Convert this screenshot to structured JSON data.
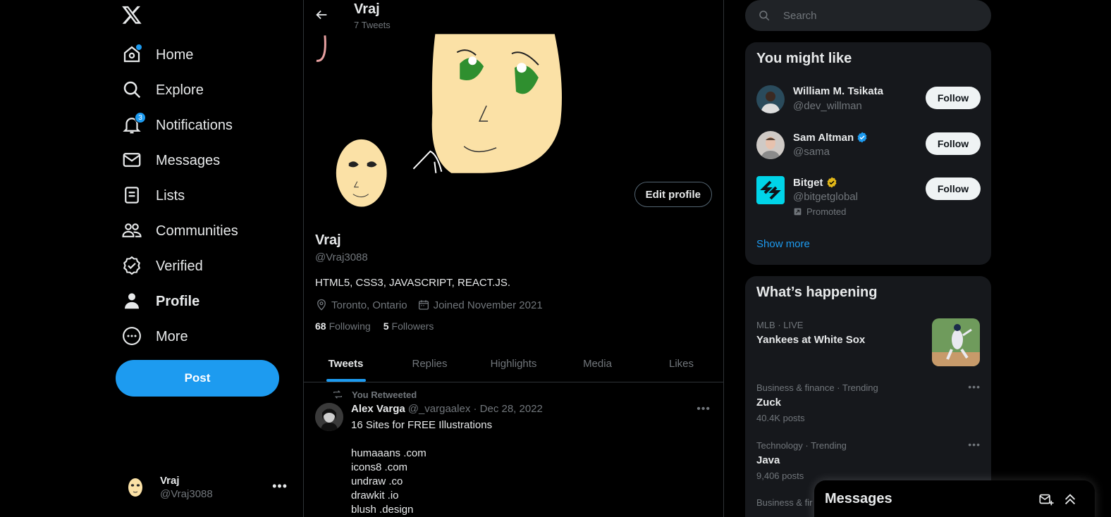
{
  "nav": {
    "items": [
      {
        "label": "Home",
        "icon": "home-icon"
      },
      {
        "label": "Explore",
        "icon": "search-icon"
      },
      {
        "label": "Notifications",
        "icon": "bell-icon",
        "badge": "3"
      },
      {
        "label": "Messages",
        "icon": "envelope-icon"
      },
      {
        "label": "Lists",
        "icon": "list-icon"
      },
      {
        "label": "Communities",
        "icon": "people-icon"
      },
      {
        "label": "Verified",
        "icon": "verified-badge-icon"
      },
      {
        "label": "Profile",
        "icon": "person-icon"
      },
      {
        "label": "More",
        "icon": "more-circle-icon"
      }
    ],
    "post_label": "Post"
  },
  "account": {
    "name": "Vraj",
    "handle": "@Vraj3088"
  },
  "header": {
    "name": "Vraj",
    "tweet_count": "7 Tweets"
  },
  "profile": {
    "edit_label": "Edit profile",
    "name": "Vraj",
    "handle": "@Vraj3088",
    "bio": "HTML5, CSS3,  JAVASCRIPT, REACT.JS.",
    "location": "Toronto, Ontario",
    "joined": "Joined November 2021",
    "following_count": "68",
    "following_label": "Following",
    "followers_count": "5",
    "followers_label": "Followers"
  },
  "tabs": [
    "Tweets",
    "Replies",
    "Highlights",
    "Media",
    "Likes"
  ],
  "tweet": {
    "retweet_label": "You Retweeted",
    "author": "Alex Varga",
    "handle_date": "@_vargaalex · Dec 28, 2022",
    "text": "16 Sites for FREE Illustrations\n\nhumaaans  .com\nicons8  .com\nundraw .co\ndrawkit .io\nblush .design"
  },
  "search": {
    "placeholder": "Search"
  },
  "you_might_like": {
    "title": "You might like",
    "users": [
      {
        "name": "William M. Tsikata",
        "handle": "@dev_willman",
        "follow": "Follow"
      },
      {
        "name": "Sam Altman",
        "handle": "@sama",
        "follow": "Follow",
        "verified": "blue"
      },
      {
        "name": "Bitget",
        "handle": "@bitgetglobal",
        "follow": "Follow",
        "verified": "gold",
        "promoted": "Promoted"
      }
    ],
    "show_more": "Show more"
  },
  "whats_happening": {
    "title": "What’s happening",
    "trends": [
      {
        "context": "MLB · LIVE",
        "title": "Yankees at White Sox"
      },
      {
        "context": "Business & finance · Trending",
        "title": "Zuck",
        "count": "40.4K posts"
      },
      {
        "context": "Technology · Trending",
        "title": "Java",
        "count": "9,406 posts"
      },
      {
        "context": "Business & fir"
      }
    ]
  },
  "messages_drawer": {
    "title": "Messages"
  },
  "colors": {
    "accent": "#1d9bf0",
    "background": "#000000",
    "card": "#16181c",
    "gold": "#e2b719"
  }
}
